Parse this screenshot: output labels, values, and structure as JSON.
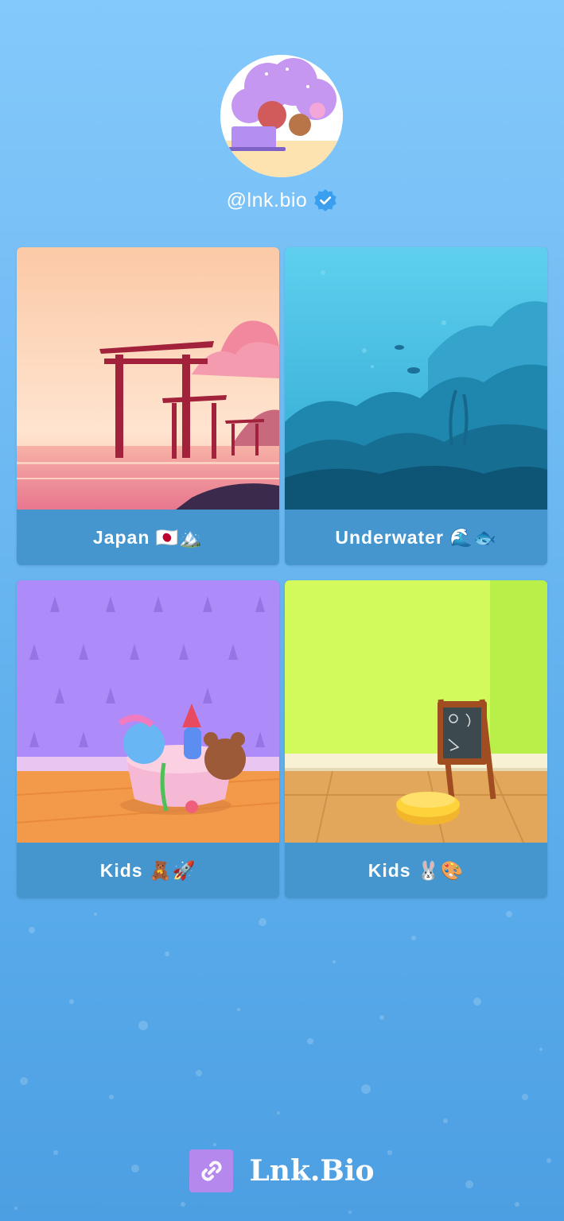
{
  "profile": {
    "handle": "@lnk.bio",
    "avatar_icon": "avatar-illustration-icon",
    "verified_icon": "verified-badge-icon"
  },
  "links": [
    {
      "label": "Japan 🇯🇵🏔️",
      "thumbnail": "torii-gates-at-sunset"
    },
    {
      "label": "Underwater 🌊🐟",
      "thumbnail": "underwater-ocean-scene"
    },
    {
      "label": "Kids 🧸🚀",
      "thumbnail": "toy-basket-in-purple-room"
    },
    {
      "label": "Kids 🐰🎨",
      "thumbnail": "green-room-with-chalkboard"
    }
  ],
  "footer": {
    "brand": "Lnk.Bio",
    "logo_icon": "link-chain-icon"
  },
  "colors": {
    "background_top": "#84c9fb",
    "background_bottom": "#4c9fe2",
    "card_label": "#4596cf",
    "logo_accent": "#b588ee"
  }
}
